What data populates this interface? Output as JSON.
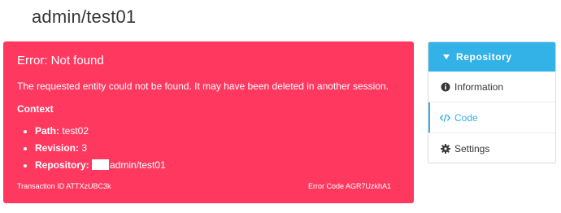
{
  "page_title": "admin/test01",
  "error": {
    "title": "Error: Not found",
    "message": "The requested entity could not be found. It may have been deleted in another session.",
    "context_heading": "Context",
    "context": [
      {
        "key": "Path:",
        "value": "test02"
      },
      {
        "key": "Revision:",
        "value": "3"
      },
      {
        "key": "Repository:",
        "value": "admin/test01"
      }
    ],
    "transaction_id": "Transaction ID ATTXzUBC3k",
    "error_code": "Error Code AGR7UzkhA1",
    "color": "#ff3860"
  },
  "sidebar": {
    "header": "Repository",
    "accent_color": "#33b2e8",
    "items": [
      {
        "label": "Information",
        "icon": "info-circle-icon"
      },
      {
        "label": "Code",
        "icon": "code-icon",
        "active": true
      },
      {
        "label": "Settings",
        "icon": "gear-icon"
      }
    ]
  }
}
